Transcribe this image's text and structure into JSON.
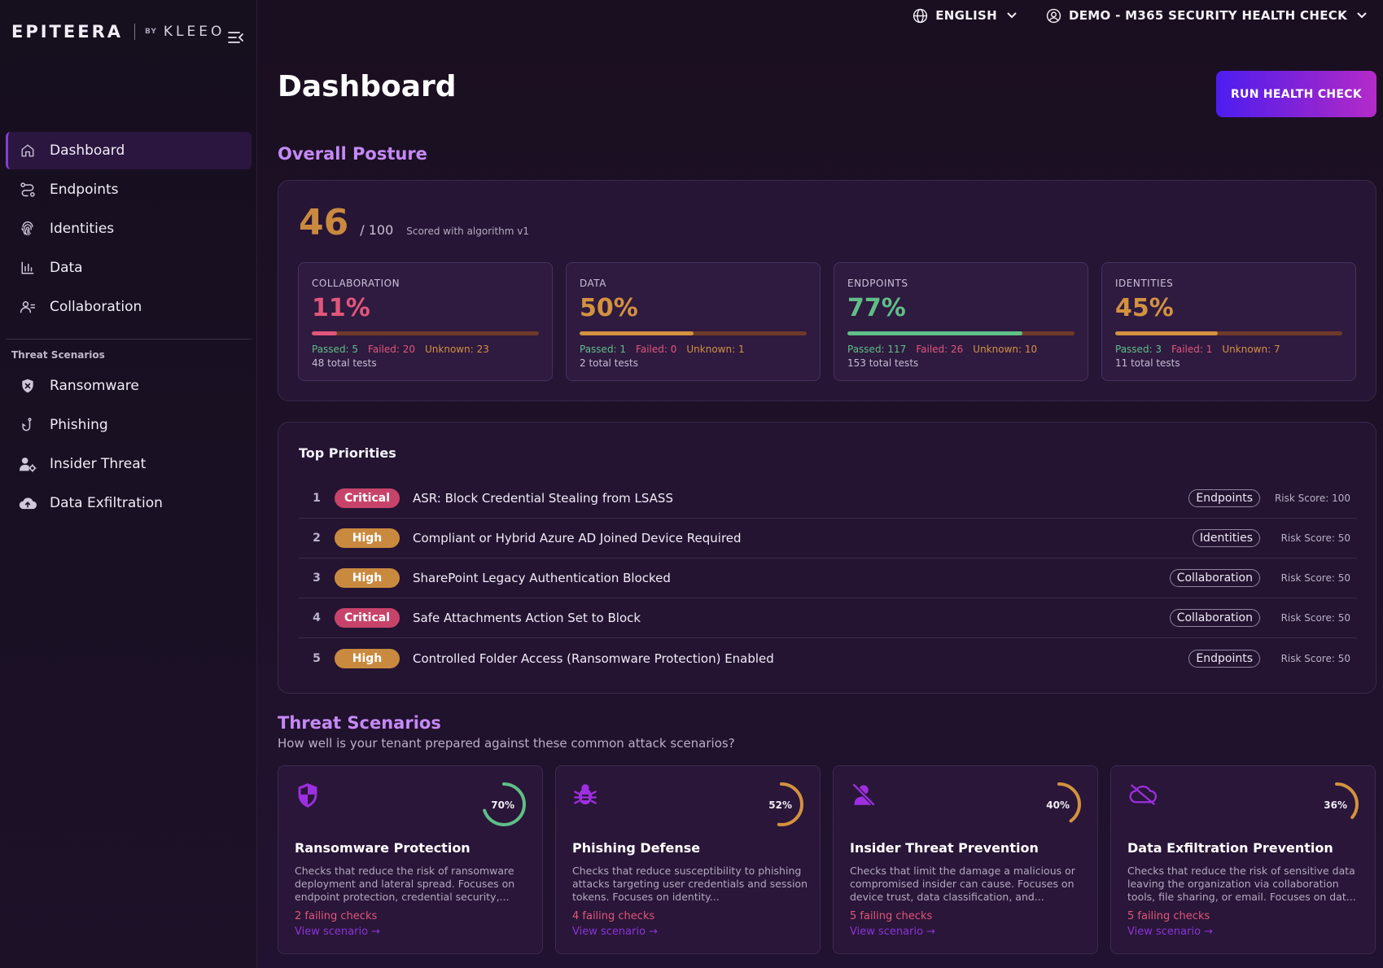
{
  "brand": {
    "name": "EPITEERA",
    "by": "BY",
    "sub": "KLEEO"
  },
  "topbar": {
    "language": "ENGLISH",
    "account": "DEMO - M365 SECURITY HEALTH CHECK"
  },
  "sidebar": {
    "items": [
      {
        "label": "Dashboard",
        "icon": "home-icon",
        "active": true
      },
      {
        "label": "Endpoints",
        "icon": "route-icon"
      },
      {
        "label": "Identities",
        "icon": "fingerprint-icon"
      },
      {
        "label": "Data",
        "icon": "bar-chart-icon"
      },
      {
        "label": "Collaboration",
        "icon": "users-icon"
      }
    ],
    "section_label": "Threat Scenarios",
    "scenarios": [
      {
        "label": "Ransomware",
        "icon": "shield-x-icon"
      },
      {
        "label": "Phishing",
        "icon": "hook-icon"
      },
      {
        "label": "Insider Threat",
        "icon": "user-gear-icon"
      },
      {
        "label": "Data Exfiltration",
        "icon": "cloud-upload-icon"
      }
    ]
  },
  "main": {
    "title": "Dashboard",
    "run_button": "RUN HEALTH CHECK",
    "posture_title": "Overall Posture",
    "score": {
      "value": "46",
      "max": "/ 100",
      "algorithm": "Scored with algorithm v1"
    },
    "categories": [
      {
        "label": "COLLABORATION",
        "pct": "11%",
        "fraction": 0.11,
        "color": "#e0577a",
        "passed": "Passed: 5",
        "failed": "Failed: 20",
        "unknown": "Unknown: 23",
        "total": "48 total tests"
      },
      {
        "label": "DATA",
        "pct": "50%",
        "fraction": 0.5,
        "color": "#d3923f",
        "passed": "Passed: 1",
        "failed": "Failed: 0",
        "unknown": "Unknown: 1",
        "total": "2 total tests"
      },
      {
        "label": "ENDPOINTS",
        "pct": "77%",
        "fraction": 0.77,
        "color": "#5fbf86",
        "passed": "Passed: 117",
        "failed": "Failed: 26",
        "unknown": "Unknown: 10",
        "total": "153 total tests"
      },
      {
        "label": "IDENTITIES",
        "pct": "45%",
        "fraction": 0.45,
        "color": "#d3923f",
        "passed": "Passed: 3",
        "failed": "Failed: 1",
        "unknown": "Unknown: 7",
        "total": "11 total tests"
      }
    ],
    "priorities_title": "Top Priorities",
    "priorities": [
      {
        "num": "1",
        "severity": "Critical",
        "name": "ASR: Block Credential Stealing from LSASS",
        "tag": "Endpoints",
        "risk": "Risk Score: 100"
      },
      {
        "num": "2",
        "severity": "High",
        "name": "Compliant or Hybrid Azure AD Joined Device Required",
        "tag": "Identities",
        "risk": "Risk Score: 50"
      },
      {
        "num": "3",
        "severity": "High",
        "name": "SharePoint Legacy Authentication Blocked",
        "tag": "Collaboration",
        "risk": "Risk Score: 50"
      },
      {
        "num": "4",
        "severity": "Critical",
        "name": "Safe Attachments Action Set to Block",
        "tag": "Collaboration",
        "risk": "Risk Score: 50"
      },
      {
        "num": "5",
        "severity": "High",
        "name": "Controlled Folder Access (Ransomware Protection) Enabled",
        "tag": "Endpoints",
        "risk": "Risk Score: 50"
      }
    ],
    "severity_colors": {
      "Critical": "#c8436a",
      "High": "#c98a3f"
    },
    "threat_title": "Threat Scenarios",
    "threat_subtitle": "How well is your tenant prepared against these common attack scenarios?",
    "scenarios": [
      {
        "title": "Ransomware Protection",
        "pct": "70%",
        "fraction": 0.7,
        "ring_color": "#5fbf86",
        "icon": "shield-icon",
        "desc": "Checks that reduce the risk of ransomware deployment and lateral spread. Focuses on endpoint protection, credential security,...",
        "failing": "2 failing checks",
        "link": "View scenario →"
      },
      {
        "title": "Phishing Defense",
        "pct": "52%",
        "fraction": 0.52,
        "ring_color": "#d3923f",
        "icon": "bug-icon",
        "desc": "Checks that reduce susceptibility to phishing attacks targeting user credentials and session tokens. Focuses on identity...",
        "failing": "4 failing checks",
        "link": "View scenario →"
      },
      {
        "title": "Insider Threat Prevention",
        "pct": "40%",
        "fraction": 0.4,
        "ring_color": "#d3923f",
        "icon": "user-slash-icon",
        "desc": "Checks that limit the damage a malicious or compromised insider can cause. Focuses on device trust, data classification, and...",
        "failing": "5 failing checks",
        "link": "View scenario →"
      },
      {
        "title": "Data Exfiltration Prevention",
        "pct": "36%",
        "fraction": 0.36,
        "ring_color": "#d3923f",
        "icon": "cloud-off-icon",
        "desc": "Checks that reduce the risk of sensitive data leaving the organization via collaboration tools, file sharing, or email. Focuses on dat...",
        "failing": "5 failing checks",
        "link": "View scenario →"
      }
    ]
  }
}
